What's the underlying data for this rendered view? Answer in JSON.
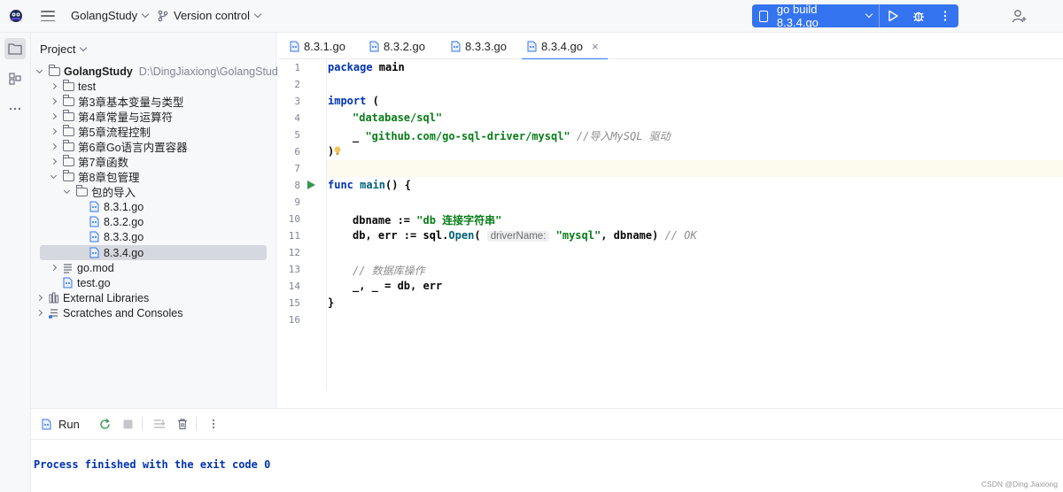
{
  "titlebar": {
    "project_name": "GolangStudy",
    "vcs_label": "Version control",
    "run_config": "go build 8.3.4.go"
  },
  "project_panel": {
    "title": "Project",
    "tree": [
      {
        "label": "GolangStudy",
        "path": "D:\\DingJiaxiong\\GolangStudy",
        "type": "folder",
        "expanded": true
      },
      {
        "label": "test",
        "type": "folder"
      },
      {
        "label": "第3章基本变量与类型",
        "type": "folder"
      },
      {
        "label": "第4章常量与运算符",
        "type": "folder"
      },
      {
        "label": "第5章流程控制",
        "type": "folder"
      },
      {
        "label": "第6章Go语言内置容器",
        "type": "folder"
      },
      {
        "label": "第7章函数",
        "type": "folder"
      },
      {
        "label": "第8章包管理",
        "type": "folder",
        "expanded": true
      },
      {
        "label": "包的导入",
        "type": "folder",
        "expanded": true
      },
      {
        "label": "8.3.1.go",
        "type": "gofile"
      },
      {
        "label": "8.3.2.go",
        "type": "gofile"
      },
      {
        "label": "8.3.3.go",
        "type": "gofile"
      },
      {
        "label": "8.3.4.go",
        "type": "gofile",
        "selected": true
      },
      {
        "label": "go.mod",
        "type": "mod"
      },
      {
        "label": "test.go",
        "type": "gofile"
      },
      {
        "label": "External Libraries",
        "type": "libs"
      },
      {
        "label": "Scratches and Consoles",
        "type": "scratch"
      }
    ]
  },
  "tabs": [
    {
      "label": "8.3.1.go"
    },
    {
      "label": "8.3.2.go"
    },
    {
      "label": "8.3.3.go"
    },
    {
      "label": "8.3.4.go",
      "active": true
    }
  ],
  "editor": {
    "line_numbers": [
      "1",
      "2",
      "3",
      "4",
      "5",
      "6",
      "7",
      "8",
      "9",
      "10",
      "11",
      "12",
      "13",
      "14",
      "15",
      "16"
    ],
    "code": {
      "l1_kw": "package",
      "l1_name": " main",
      "l3_kw": "import",
      "l3_rest": " (",
      "l4_str": "\"database/sql\"",
      "l5_under": "_ ",
      "l5_str": "\"github.com/go-sql-driver/mysql\"",
      "l5_cmt": " //导入MySQL 驱动",
      "l6": ")",
      "l8_kw": "func",
      "l8_fn": " main",
      "l8_rest": "() {",
      "l10_a": "dbname := ",
      "l10_str": "\"db 连接字符串\"",
      "l11_a": "db, err := ",
      "l11_pkg": "sql",
      "l11_b": ".",
      "l11_fn": "Open",
      "l11_c": "( ",
      "l11_hint": "driverName:",
      "l11_str": " \"mysql\"",
      "l11_d": ", dbname) ",
      "l11_cmt": "// OK",
      "l13_cmt": "// 数据库操作",
      "l14": "_, _ = db, err",
      "l15": "}"
    }
  },
  "run_window": {
    "tab_label": "Run",
    "console_output": "Process finished with the exit code 0"
  },
  "watermark": "CSDN @Ding Jiaxiong",
  "colors": {
    "accent": "#3574f0",
    "keyword": "#0033b3",
    "string": "#067d17"
  }
}
